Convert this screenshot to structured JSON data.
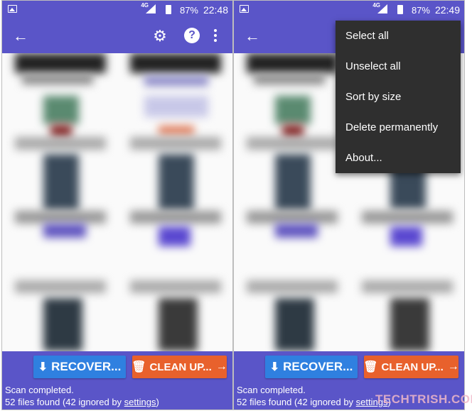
{
  "left": {
    "status": {
      "network": "4G",
      "battery": "87%",
      "time": "22:48"
    },
    "toolbar": {
      "back_icon": "back-arrow-icon",
      "settings_icon": "gear-icon",
      "help_icon": "help-icon",
      "more_icon": "overflow-menu-icon",
      "help_glyph": "?"
    },
    "recover_label": "RECOVER...",
    "cleanup_label": "CLEAN UP...",
    "scan_status": "Scan completed.",
    "files_found_prefix": "52 files found (42 ignored by ",
    "settings_link": "settings",
    "files_found_suffix": ")"
  },
  "right": {
    "status": {
      "network": "4G",
      "battery": "87%",
      "time": "22:49"
    },
    "menu": {
      "items": [
        "Select all",
        "Unselect all",
        "Sort by size",
        "Delete permanently",
        "About..."
      ]
    },
    "recover_label": "RECOVER...",
    "cleanup_label": "CLEAN UP...",
    "scan_status": "Scan completed.",
    "files_found_prefix": "52 files found (42 ignored by ",
    "settings_link": "settings",
    "files_found_suffix": ")"
  },
  "watermark": "TECHTRISH.COM",
  "colors": {
    "primary": "#5a55c8",
    "recover": "#2f80e0",
    "cleanup": "#e8612c",
    "menu_bg": "#2f2f2f"
  }
}
